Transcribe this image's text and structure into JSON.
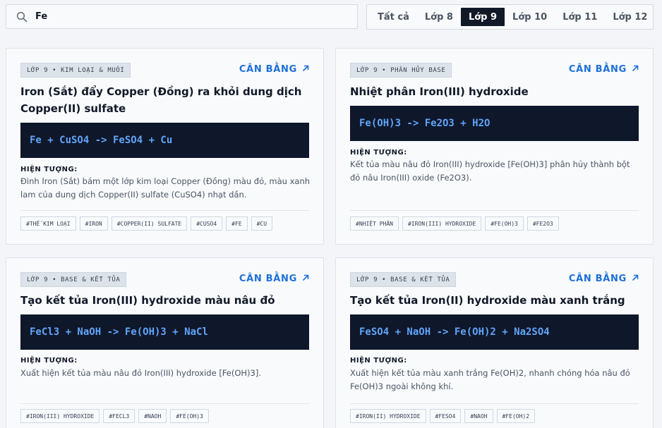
{
  "search": {
    "value": "Fe",
    "icon": "search-icon"
  },
  "grade_tabs": [
    {
      "label": "Tất cả",
      "active": false
    },
    {
      "label": "Lớp 8",
      "active": false
    },
    {
      "label": "Lớp 9",
      "active": true
    },
    {
      "label": "Lớp 10",
      "active": false
    },
    {
      "label": "Lớp 11",
      "active": false
    },
    {
      "label": "Lớp 12",
      "active": false
    }
  ],
  "balance_label": "CÂN BẰNG",
  "phenomenon_label": "HIỆN TƯỢNG:",
  "colors": {
    "accent": "#1d6fd8",
    "equation_bg": "#0f172a",
    "equation_text": "#60a5fa",
    "active_tab": "#111827"
  },
  "cards": [
    {
      "badge": "LỚP 9 • KIM LOẠI & MUỐI",
      "title": "Iron (Sắt) đẩy Copper (Đồng) ra khỏi dung dịch Copper(II) sulfate",
      "equation": "Fe + CuSO4 -> FeSO4 + Cu",
      "phenomenon": "Đinh Iron (Sắt) bám một lớp kim loại Copper (Đồng) màu đỏ, màu xanh lam của dung dịch Copper(II) sulfate (CuSO4) nhạt dần.",
      "tags": [
        "#THẾ KIM LOẠI",
        "#IRON",
        "#COPPER(II) SULFATE",
        "#CUSO4",
        "#FE",
        "#CU"
      ]
    },
    {
      "badge": "LỚP 9 • PHÂN HỦY BASE",
      "title": "Nhiệt phân Iron(III) hydroxide",
      "equation": "Fe(OH)3 -> Fe2O3 + H2O",
      "phenomenon": "Kết tủa màu nâu đỏ Iron(III) hydroxide [Fe(OH)3] phân hủy thành bột đỏ nâu Iron(III) oxide (Fe2O3).",
      "tags": [
        "#NHIỆT PHÂN",
        "#IRON(III) HYDROXIDE",
        "#FE(OH)3",
        "#FE2O3"
      ]
    },
    {
      "badge": "LỚP 9 • BASE & KẾT TỦA",
      "title": "Tạo kết tủa Iron(III) hydroxide màu nâu đỏ",
      "equation": "FeCl3 + NaOH -> Fe(OH)3 + NaCl",
      "phenomenon": "Xuất hiện kết tủa màu nâu đỏ Iron(III) hydroxide [Fe(OH)3].",
      "tags": [
        "#IRON(III) HYDROXIDE",
        "#FECL3",
        "#NAOH",
        "#FE(OH)3"
      ]
    },
    {
      "badge": "LỚP 9 • BASE & KẾT TỦA",
      "title": "Tạo kết tủa Iron(II) hydroxide màu xanh trắng",
      "equation": "FeSO4 + NaOH -> Fe(OH)2 + Na2SO4",
      "phenomenon": "Xuất hiện kết tủa màu xanh trắng Fe(OH)2, nhanh chóng hóa nâu đỏ Fe(OH)3 ngoài không khí.",
      "tags": [
        "#IRON(II) HYDROXIDE",
        "#FESO4",
        "#NAOH",
        "#FE(OH)2"
      ]
    }
  ]
}
